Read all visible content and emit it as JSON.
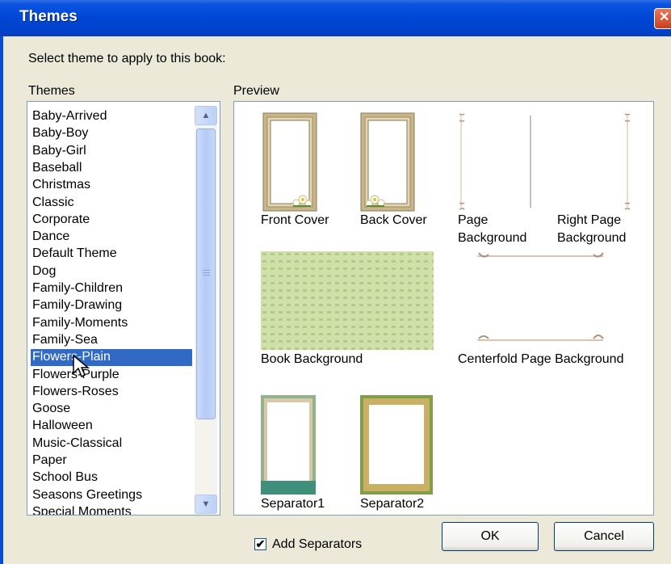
{
  "window": {
    "title": "Themes",
    "close_glyph": "✕"
  },
  "prompt": "Select theme to apply to this book:",
  "themes_label": "Themes",
  "preview_label": "Preview",
  "themes": [
    "Baby-Arrived",
    "Baby-Boy",
    "Baby-Girl",
    "Baseball",
    "Christmas",
    "Classic",
    "Corporate",
    "Dance",
    "Default Theme",
    "Dog",
    "Family-Children",
    "Family-Drawing",
    "Family-Moments",
    "Family-Sea",
    "Flowers-Plain",
    "Flowers-Purple",
    "Flowers-Roses",
    "Goose",
    "Halloween",
    "Music-Classical",
    "Paper",
    "School Bus",
    "Seasons Greetings",
    "Special Moments"
  ],
  "selected_theme": "Flowers-Plain",
  "preview": {
    "front_cover": "Front Cover",
    "back_cover": "Back Cover",
    "page_bg_line1": "Page",
    "page_bg_line2": "Background",
    "right_page_line1": "Right Page",
    "right_page_line2": "Background",
    "book_background": "Book Background",
    "centerfold": "Centerfold Page Background",
    "separator1": "Separator1",
    "separator2": "Separator2"
  },
  "add_separators": {
    "label": "Add Separators",
    "checked": true,
    "check_glyph": "✔"
  },
  "buttons": {
    "ok": "OK",
    "cancel": "Cancel"
  },
  "icons": {
    "scroll_up": "▲",
    "scroll_down": "▼",
    "cursor": "arrow-cursor-icon"
  }
}
